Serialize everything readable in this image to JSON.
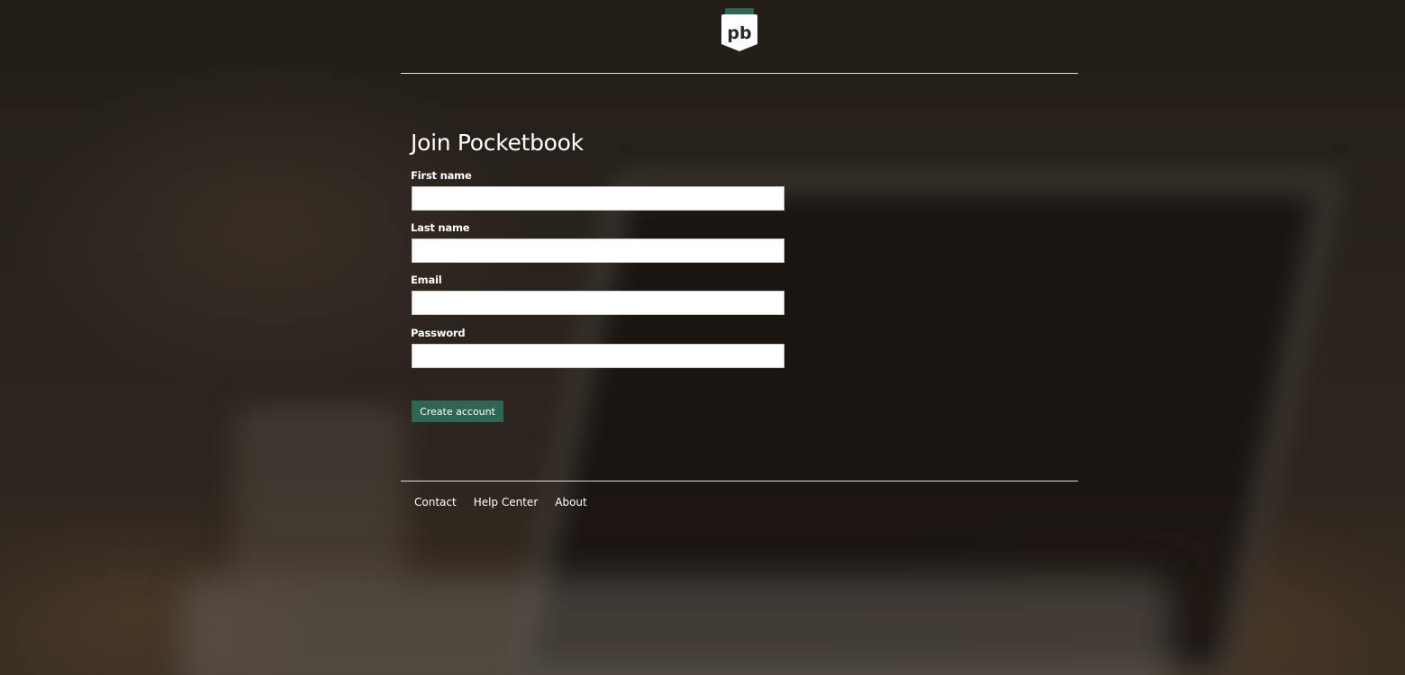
{
  "brand": {
    "logo_text": "pb",
    "accent_color": "#2e6553"
  },
  "signup": {
    "title": "Join Pocketbook",
    "fields": [
      {
        "label": "First name",
        "value": "",
        "placeholder": ""
      },
      {
        "label": "Last name",
        "value": "",
        "placeholder": ""
      },
      {
        "label": "Email",
        "value": "",
        "placeholder": ""
      },
      {
        "label": "Password",
        "value": "",
        "placeholder": ""
      }
    ],
    "submit_label": "Create account"
  },
  "footer": {
    "links": [
      "Contact",
      "Help Center",
      "About"
    ]
  }
}
